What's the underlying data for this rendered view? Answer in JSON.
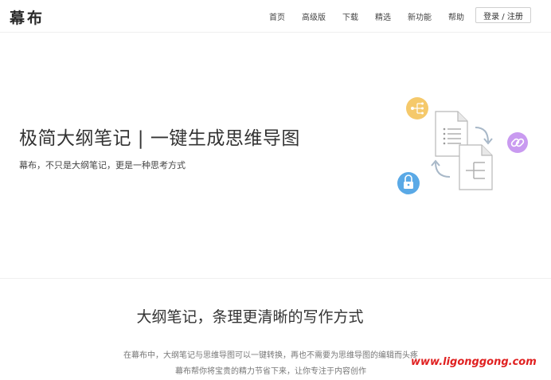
{
  "header": {
    "logo": "幕布",
    "nav": [
      "首页",
      "高级版",
      "下载",
      "精选",
      "新功能",
      "帮助"
    ],
    "login_label": "登录 / 注册"
  },
  "hero": {
    "title": "极简大纲笔记 | 一键生成思维导图",
    "subtitle": "幕布，不只是大纲笔记，更是一种思考方式"
  },
  "section": {
    "title": "大纲笔记，条理更清晰的写作方式",
    "desc_line1": "在幕布中，大纲笔记与思维导图可以一键转换，再也不需要为思维导图的编辑而头疼",
    "desc_line2": "幕布帮你将宝贵的精力节省下来，让你专注于内容创作"
  },
  "watermark": "www.ligonggong.com",
  "colors": {
    "mindmap_badge": "#f5c96b",
    "link_badge": "#c99af0",
    "lock_badge": "#5aa9e6",
    "doc_stroke": "#b8b8b8",
    "arrow": "#a8b8c8",
    "watermark": "#e02020"
  },
  "icons": [
    "mindmap-icon",
    "link-icon",
    "lock-icon",
    "outline-document-icon",
    "mindmap-document-icon",
    "sync-arrow-icon"
  ]
}
